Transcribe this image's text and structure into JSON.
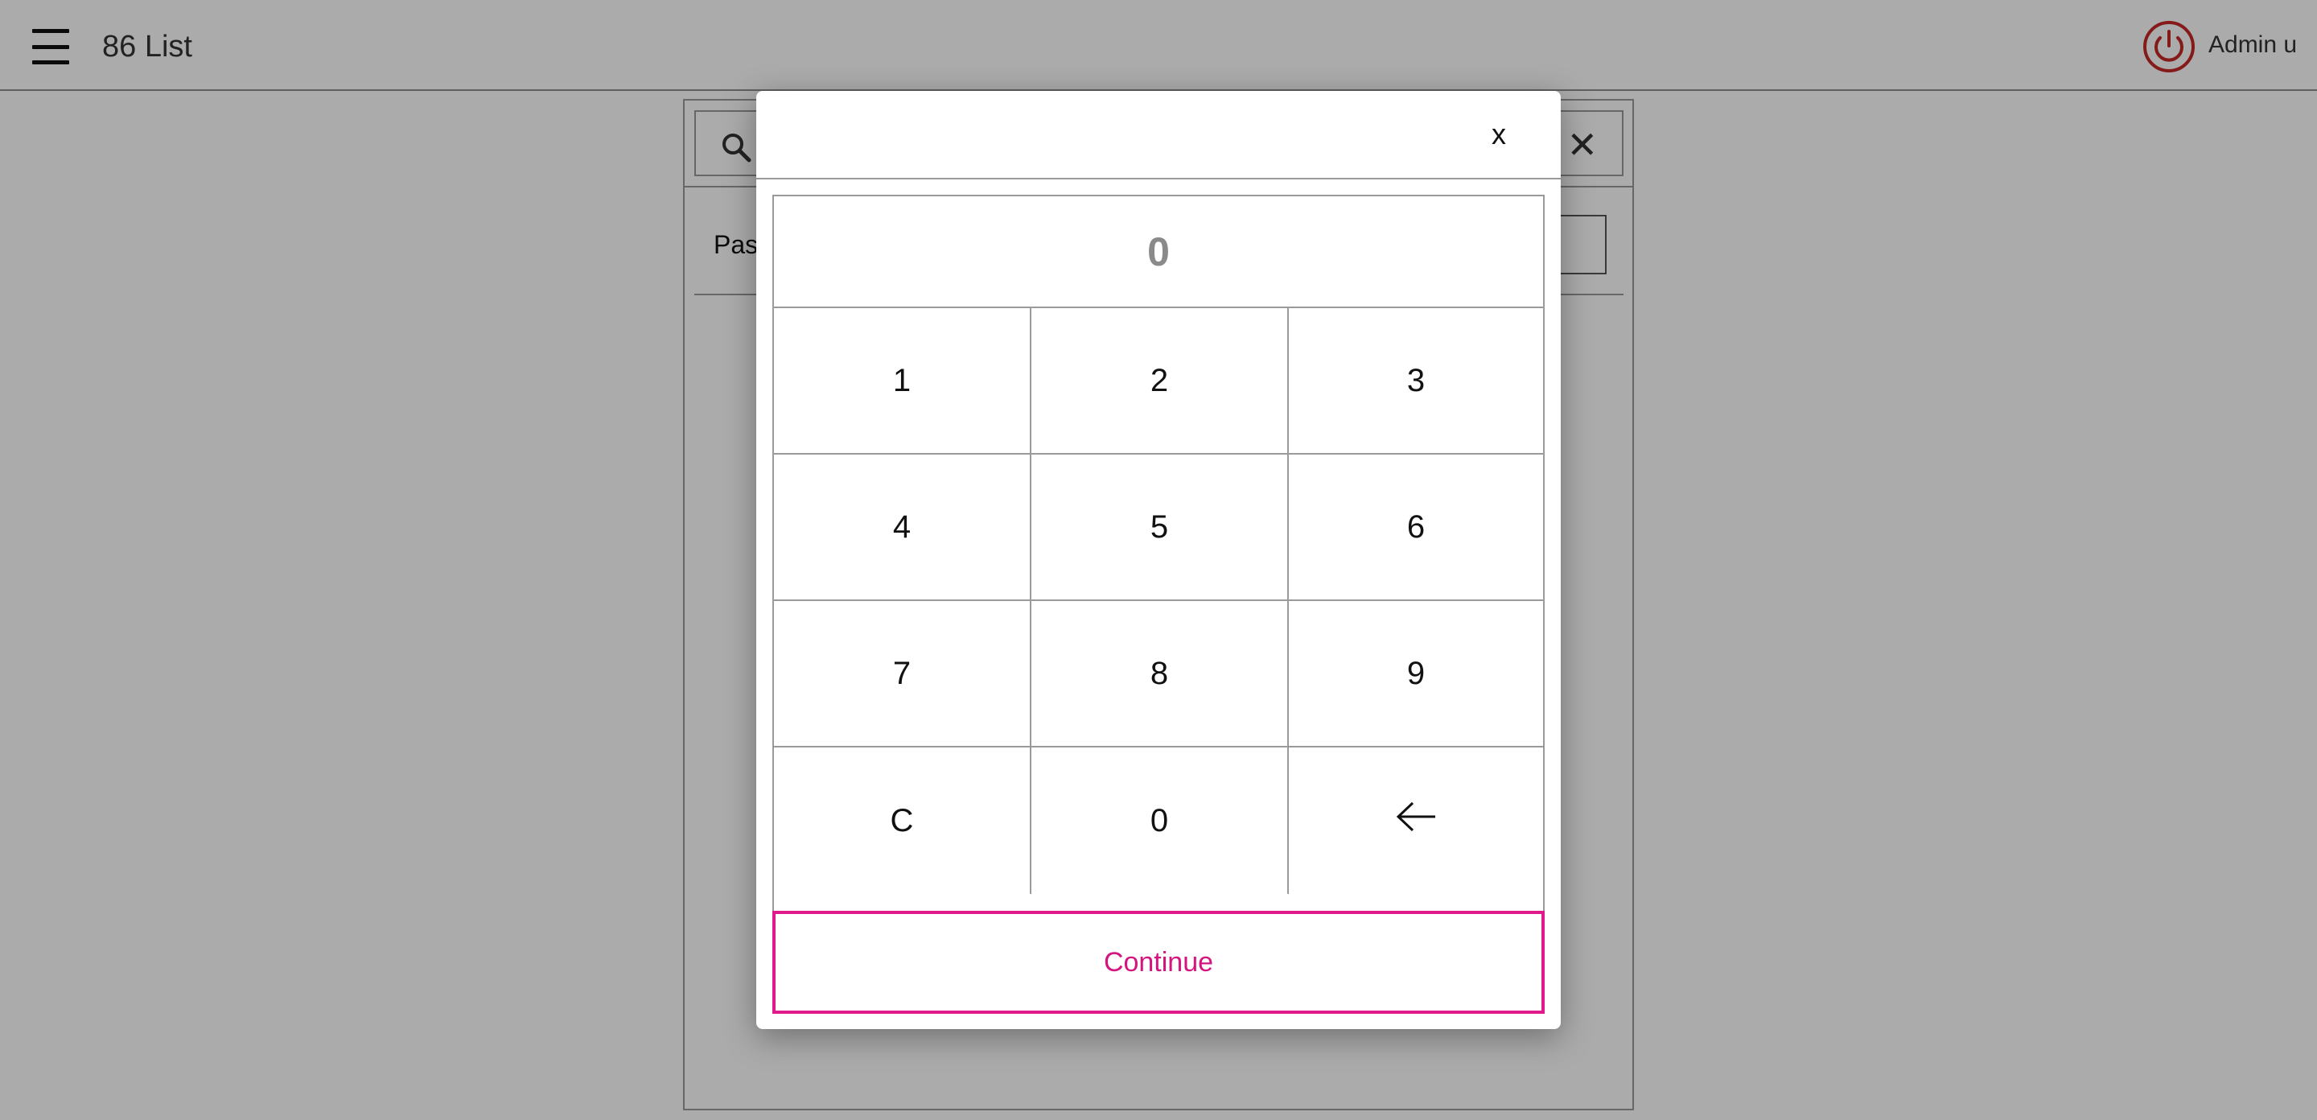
{
  "header": {
    "menu_icon": "hamburger-menu-icon",
    "title": "86 List",
    "power_icon": "power-icon",
    "user_name": "Admin u",
    "power_color": "#c62828"
  },
  "background": {
    "search_icon": "search-icon",
    "clear_icon": "close-icon",
    "clear_glyph": "✕",
    "row_label": "Pas"
  },
  "modal": {
    "close_label": "x",
    "display_value": "0",
    "keys": [
      {
        "label": "1"
      },
      {
        "label": "2"
      },
      {
        "label": "3"
      },
      {
        "label": "4"
      },
      {
        "label": "5"
      },
      {
        "label": "6"
      },
      {
        "label": "7"
      },
      {
        "label": "8"
      },
      {
        "label": "9"
      },
      {
        "label": "C"
      },
      {
        "label": "0"
      },
      {
        "label": "",
        "icon": "backspace-arrow-icon"
      }
    ],
    "continue_label": "Continue",
    "accent_color": "#e01a8a"
  }
}
